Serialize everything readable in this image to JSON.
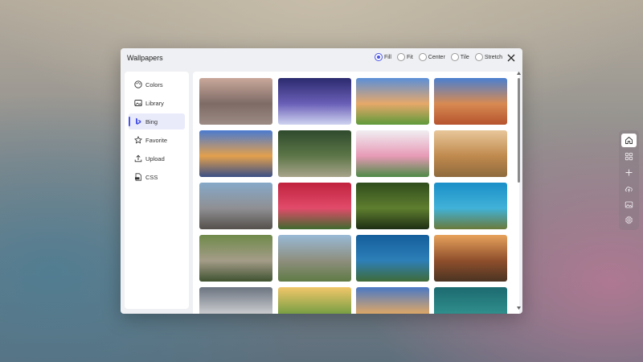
{
  "dialog": {
    "title": "Wallpapers",
    "fit_options": [
      {
        "label": "Fill",
        "checked": true
      },
      {
        "label": "Fit",
        "checked": false
      },
      {
        "label": "Center",
        "checked": false
      },
      {
        "label": "Tile",
        "checked": false
      },
      {
        "label": "Stretch",
        "checked": false
      }
    ]
  },
  "sidebar": {
    "items": [
      {
        "label": "Colors",
        "icon": "palette-icon",
        "active": false
      },
      {
        "label": "Library",
        "icon": "image-icon",
        "active": false
      },
      {
        "label": "Bing",
        "icon": "bing-icon",
        "active": true
      },
      {
        "label": "Favorite",
        "icon": "star-icon",
        "active": false
      },
      {
        "label": "Upload",
        "icon": "upload-icon",
        "active": false
      },
      {
        "label": "CSS",
        "icon": "css-file-icon",
        "active": false
      }
    ]
  },
  "gallery": {
    "thumbnails": [
      {
        "subject": "misty-lake-trees",
        "colors": [
          "#c9a89a",
          "#7e6b66",
          "#9c8a84"
        ]
      },
      {
        "subject": "starry-sky-rock",
        "colors": [
          "#2b2a6e",
          "#6a5fb7",
          "#cfd3f0"
        ]
      },
      {
        "subject": "green-hill-sunset",
        "colors": [
          "#5b8fd8",
          "#e6a86a",
          "#5f9a3a"
        ]
      },
      {
        "subject": "red-rock-arch",
        "colors": [
          "#4a7fd0",
          "#d88a52",
          "#b5532e"
        ]
      },
      {
        "subject": "river-city-night",
        "colors": [
          "#4a7ad0",
          "#e3a04d",
          "#3a4f86"
        ]
      },
      {
        "subject": "winding-river-forest",
        "colors": [
          "#2e4a2c",
          "#5d7648",
          "#a7a38a"
        ]
      },
      {
        "subject": "pink-flowers",
        "colors": [
          "#f1eef2",
          "#e79ab6",
          "#4e8a46"
        ]
      },
      {
        "subject": "giraffes-savanna",
        "colors": [
          "#e8c79a",
          "#c08a4e",
          "#8e6a3d"
        ]
      },
      {
        "subject": "rocky-shore",
        "colors": [
          "#86a9c9",
          "#8f8f93",
          "#55504b"
        ]
      },
      {
        "subject": "butterfly-flower",
        "colors": [
          "#c0223d",
          "#e14b6a",
          "#3f6a2e"
        ]
      },
      {
        "subject": "green-canopy-tree",
        "colors": [
          "#2f4d1c",
          "#5f7e2f",
          "#1d2e14"
        ]
      },
      {
        "subject": "sea-turtle",
        "colors": [
          "#1a8fc8",
          "#41b2d8",
          "#6a7a3a"
        ]
      },
      {
        "subject": "cranes-grass",
        "colors": [
          "#6f8a4a",
          "#a49c88",
          "#3f5230"
        ]
      },
      {
        "subject": "mountain-ruins",
        "colors": [
          "#98b9d6",
          "#8e8f7e",
          "#5f7a45"
        ]
      },
      {
        "subject": "heart-island",
        "colors": [
          "#145e9c",
          "#2d7fb8",
          "#3f6b38"
        ]
      },
      {
        "subject": "canyon-sunset",
        "colors": [
          "#e7a25c",
          "#8f4f2c",
          "#4a3322"
        ]
      },
      {
        "subject": "coastal-hills",
        "colors": [
          "#6b7480",
          "#c7c9cc",
          "#2e3a2c"
        ]
      },
      {
        "subject": "golden-valley",
        "colors": [
          "#f2c66a",
          "#7da045",
          "#3c5c2c"
        ]
      },
      {
        "subject": "old-town-street",
        "colors": [
          "#4a78c4",
          "#d9a66a",
          "#6b4a2f"
        ]
      },
      {
        "subject": "underwater-seals",
        "colors": [
          "#1c6a70",
          "#2f8d8a",
          "#0f3b3f"
        ]
      }
    ]
  },
  "dock": {
    "buttons": [
      {
        "icon": "home-icon",
        "active": true
      },
      {
        "icon": "widgets-icon",
        "active": false
      },
      {
        "icon": "plus-icon",
        "active": false
      },
      {
        "icon": "cloud-upload-icon",
        "active": false
      },
      {
        "icon": "image-icon",
        "active": false
      },
      {
        "icon": "gear-icon",
        "active": false
      }
    ]
  }
}
